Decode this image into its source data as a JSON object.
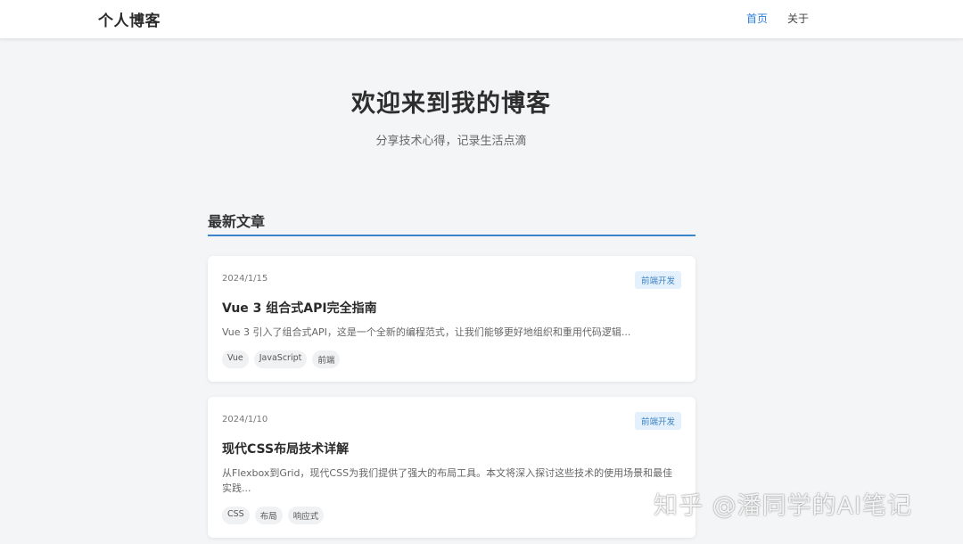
{
  "header": {
    "brand": "个人博客",
    "nav": [
      {
        "label": "首页",
        "active": true
      },
      {
        "label": "关于",
        "active": false
      }
    ]
  },
  "hero": {
    "title": "欢迎来到我的博客",
    "subtitle": "分享技术心得，记录生活点滴"
  },
  "section": {
    "title": "最新文章"
  },
  "posts": [
    {
      "date": "2024/1/15",
      "category": "前端开发",
      "title": "Vue 3 组合式API完全指南",
      "excerpt": "Vue 3 引入了组合式API，这是一个全新的编程范式，让我们能够更好地组织和重用代码逻辑...",
      "tags": [
        "Vue",
        "JavaScript",
        "前端"
      ]
    },
    {
      "date": "2024/1/10",
      "category": "前端开发",
      "title": "现代CSS布局技术详解",
      "excerpt": "从Flexbox到Grid，现代CSS为我们提供了强大的布局工具。本文将深入探讨这些技术的使用场景和最佳实践...",
      "tags": [
        "CSS",
        "布局",
        "响应式"
      ]
    }
  ],
  "watermark": "知乎 @潘同学的AI笔记",
  "colors": {
    "accent": "#2f7fd8",
    "section_line": "#3a86c8",
    "category_bg": "#e4f0fb",
    "background": "#f4f5f7"
  }
}
